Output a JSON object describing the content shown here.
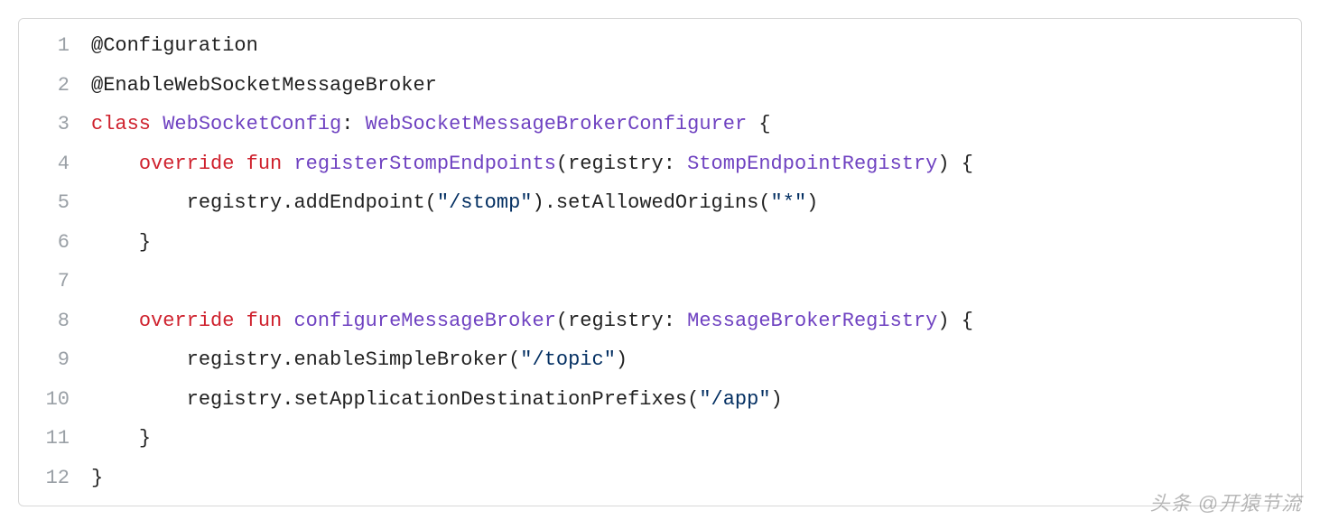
{
  "code": {
    "lines": [
      {
        "n": "1",
        "indent": 0,
        "tokens": [
          {
            "t": "@Configuration",
            "c": "tok-annotation"
          }
        ]
      },
      {
        "n": "2",
        "indent": 0,
        "tokens": [
          {
            "t": "@EnableWebSocketMessageBroker",
            "c": "tok-annotation"
          }
        ]
      },
      {
        "n": "3",
        "indent": 0,
        "tokens": [
          {
            "t": "class",
            "c": "tok-keyword"
          },
          {
            "t": " ",
            "c": ""
          },
          {
            "t": "WebSocketConfig",
            "c": "tok-type"
          },
          {
            "t": ": ",
            "c": "tok-punct"
          },
          {
            "t": "WebSocketMessageBrokerConfigurer",
            "c": "tok-type"
          },
          {
            "t": " {",
            "c": "tok-punct"
          }
        ]
      },
      {
        "n": "4",
        "indent": 1,
        "tokens": [
          {
            "t": "override",
            "c": "tok-keyword"
          },
          {
            "t": " ",
            "c": ""
          },
          {
            "t": "fun",
            "c": "tok-keyword"
          },
          {
            "t": " ",
            "c": ""
          },
          {
            "t": "registerStompEndpoints",
            "c": "tok-func"
          },
          {
            "t": "(",
            "c": "tok-punct"
          },
          {
            "t": "registry",
            "c": "tok-param"
          },
          {
            "t": ": ",
            "c": "tok-punct"
          },
          {
            "t": "StompEndpointRegistry",
            "c": "tok-type"
          },
          {
            "t": ")",
            "c": "tok-punct"
          },
          {
            "t": " {",
            "c": "tok-punct"
          }
        ]
      },
      {
        "n": "5",
        "indent": 2,
        "tokens": [
          {
            "t": "registry.addEndpoint(",
            "c": "tok-plain"
          },
          {
            "t": "\"/stomp\"",
            "c": "tok-string"
          },
          {
            "t": ").setAllowedOrigins(",
            "c": "tok-plain"
          },
          {
            "t": "\"*\"",
            "c": "tok-string"
          },
          {
            "t": ")",
            "c": "tok-plain"
          }
        ]
      },
      {
        "n": "6",
        "indent": 1,
        "tokens": [
          {
            "t": "}",
            "c": "tok-punct"
          }
        ]
      },
      {
        "n": "7",
        "indent": 0,
        "tokens": [
          {
            "t": "",
            "c": ""
          }
        ]
      },
      {
        "n": "8",
        "indent": 1,
        "tokens": [
          {
            "t": "override",
            "c": "tok-keyword"
          },
          {
            "t": " ",
            "c": ""
          },
          {
            "t": "fun",
            "c": "tok-keyword"
          },
          {
            "t": " ",
            "c": ""
          },
          {
            "t": "configureMessageBroker",
            "c": "tok-func"
          },
          {
            "t": "(",
            "c": "tok-punct"
          },
          {
            "t": "registry",
            "c": "tok-param"
          },
          {
            "t": ": ",
            "c": "tok-punct"
          },
          {
            "t": "MessageBrokerRegistry",
            "c": "tok-type"
          },
          {
            "t": ")",
            "c": "tok-punct"
          },
          {
            "t": " {",
            "c": "tok-punct"
          }
        ]
      },
      {
        "n": "9",
        "indent": 2,
        "tokens": [
          {
            "t": "registry.enableSimpleBroker(",
            "c": "tok-plain"
          },
          {
            "t": "\"/topic\"",
            "c": "tok-string"
          },
          {
            "t": ")",
            "c": "tok-plain"
          }
        ]
      },
      {
        "n": "10",
        "indent": 2,
        "tokens": [
          {
            "t": "registry.setApplicationDestinationPrefixes(",
            "c": "tok-plain"
          },
          {
            "t": "\"/app\"",
            "c": "tok-string"
          },
          {
            "t": ")",
            "c": "tok-plain"
          }
        ]
      },
      {
        "n": "11",
        "indent": 1,
        "tokens": [
          {
            "t": "}",
            "c": "tok-punct"
          }
        ]
      },
      {
        "n": "12",
        "indent": 0,
        "tokens": [
          {
            "t": "}",
            "c": "tok-punct"
          }
        ]
      }
    ],
    "indent_unit": "    "
  },
  "watermark": "头条 @开猿节流"
}
